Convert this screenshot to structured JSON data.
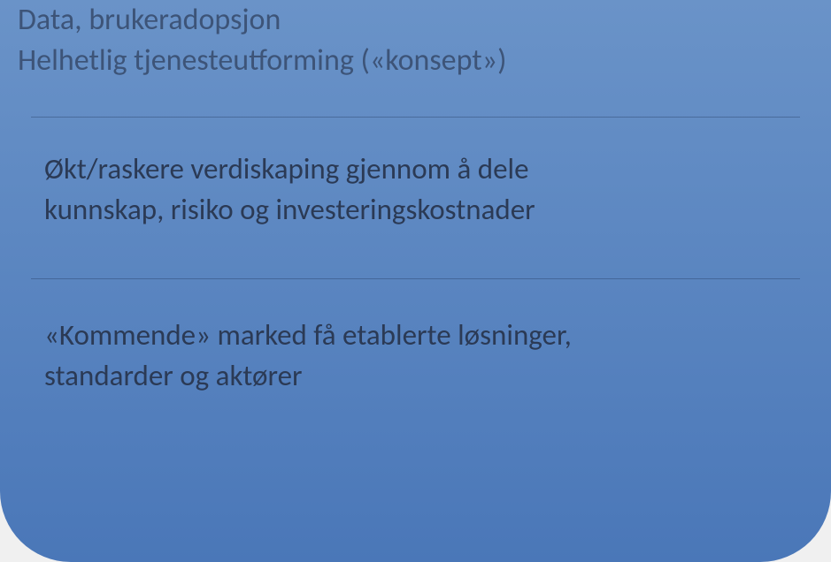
{
  "sections": {
    "top": {
      "line1": "Data, brukeradopsjon",
      "line2": "Helhetlig tjenesteutforming («konsept»)"
    },
    "middle": {
      "line1": "Økt/raskere verdiskaping gjennom å dele",
      "line2": "kunnskap, risiko og investeringskostnader"
    },
    "bottom": {
      "line1": "«Kommende» marked få etablerte løsninger,",
      "line2": "standarder og aktører"
    }
  },
  "colors": {
    "background_top": "#6a93c8",
    "background_bottom": "#4a77b8",
    "text_primary": "#2b3a55",
    "text_secondary": "#3d5478"
  }
}
